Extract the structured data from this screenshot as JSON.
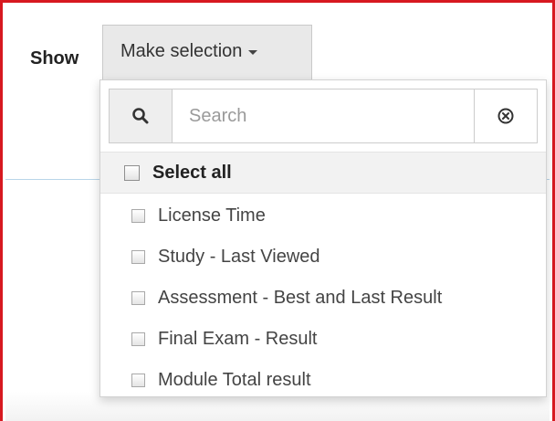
{
  "filter": {
    "show_label": "Show",
    "button_label": "Make selection",
    "search": {
      "placeholder": "Search",
      "value": ""
    },
    "select_all_label": "Select all",
    "options": [
      {
        "label": "License Time",
        "checked": false
      },
      {
        "label": "Study - Last Viewed",
        "checked": false
      },
      {
        "label": "Assessment - Best and Last Result",
        "checked": false
      },
      {
        "label": "Final Exam - Result",
        "checked": false
      },
      {
        "label": "Module Total result",
        "checked": false
      }
    ],
    "icons": {
      "search": "search-icon",
      "clear": "clear-circle-x-icon",
      "caret": "caret-down-icon"
    }
  },
  "colors": {
    "frame_border": "#d71920",
    "button_bg": "#e9e9e9",
    "divider": "#b9d5e9",
    "select_all_bg": "#f2f2f2"
  }
}
